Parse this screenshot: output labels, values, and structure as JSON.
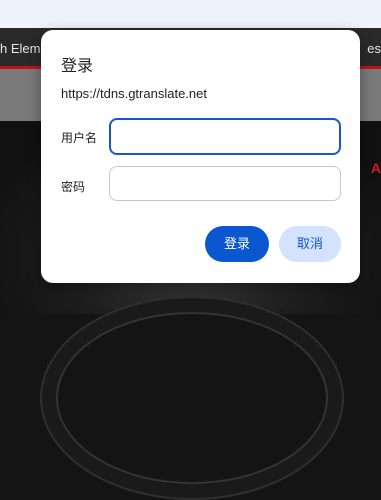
{
  "background": {
    "nav_left": "h Eleme",
    "nav_right": "es",
    "accent_text": "A"
  },
  "dialog": {
    "title": "登录",
    "origin": "https://tdns.gtranslate.net",
    "username_label": "用户名",
    "username_value": "",
    "password_label": "密码",
    "password_value": "",
    "submit_label": "登录",
    "cancel_label": "取消"
  },
  "colors": {
    "primary": "#0b57d0",
    "secondary_button": "#d3e3fd",
    "focus_border": "#1a56c4",
    "site_red": "#c4121b"
  }
}
